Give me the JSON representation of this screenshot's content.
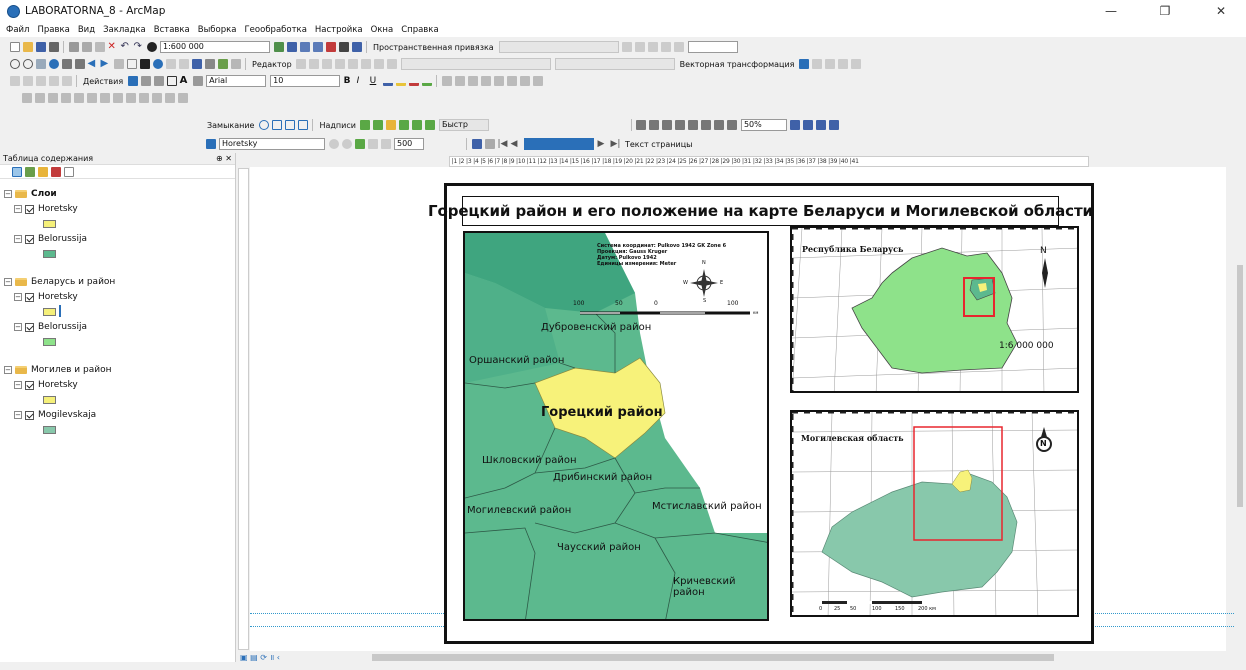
{
  "window": {
    "title": "LABORATORNA_8 - ArcMap"
  },
  "menu": [
    "Файл",
    "Правка",
    "Вид",
    "Закладка",
    "Вставка",
    "Выборка",
    "Геообработка",
    "Настройка",
    "Окна",
    "Справка"
  ],
  "toolbar": {
    "scale": "1:600 000",
    "snapping_label": "Пространственная привязка",
    "editor_label": "Редактор",
    "vector_transform_label": "Векторная трансформация",
    "actions_label": "Действия",
    "font_name": "Arial",
    "font_size": "10",
    "snap_label": "Замыкание",
    "labels_label": "Надписи",
    "quick_label": "Быстр",
    "layer_select": "Horetsky",
    "resolution": "500",
    "zoom_percent": "50%",
    "page_text_label": "Текст страницы"
  },
  "toc": {
    "title": "Таблица содержания",
    "groups": [
      {
        "name": "Слои",
        "layers": [
          {
            "name": "Horetsky",
            "color": "#f5f07a"
          },
          {
            "name": "Belorussija",
            "color": "#5cb98e"
          }
        ]
      },
      {
        "name": "Беларусь и район",
        "layers": [
          {
            "name": "Horetsky",
            "color": "#f5f07a"
          },
          {
            "name": "Belorussija",
            "color": "#8ee28a"
          }
        ]
      },
      {
        "name": "Могилев и район",
        "layers": [
          {
            "name": "Horetsky",
            "color": "#f5f07a"
          },
          {
            "name": "Mogilevskaja",
            "color": "#88c8ab"
          }
        ]
      }
    ]
  },
  "layout": {
    "title": "Горецкий район и его положение на карте Беларуси и Могилевской области",
    "main_map": {
      "coord_info": [
        "Система координат: Pulkovo 1942 GK Zone 6",
        "Проекция: Gauss Kruger",
        "Датум: Pulkovo 1942",
        "Единицы измерения: Meter"
      ],
      "scalebar": [
        "100",
        "50",
        "0",
        "100"
      ],
      "scalebar_unit": "км",
      "compass": {
        "n": "N",
        "s": "S",
        "w": "W",
        "e": "E"
      },
      "districts": [
        "Дубровенский район",
        "Оршанский район",
        "Горецкий район",
        "Шкловский район",
        "Дрибинский район",
        "Могилевский район",
        "Мстиславский район",
        "Чаусский район",
        "Кричевский район"
      ]
    },
    "map_belarus": {
      "title": "Республика Беларусь",
      "scale": "1:6 000 000",
      "north": "N"
    },
    "map_mogilev": {
      "title": "Могилевская область",
      "scalebar": [
        "0",
        "25",
        "50",
        "100",
        "150",
        "200 км"
      ],
      "north": "N"
    }
  },
  "colors": {
    "main_fill": "#5cb98e",
    "horetsky": "#f7f27a",
    "belarus": "#8ee28a",
    "mogilev": "#88c8ab",
    "extent_box": "#e8262e"
  }
}
